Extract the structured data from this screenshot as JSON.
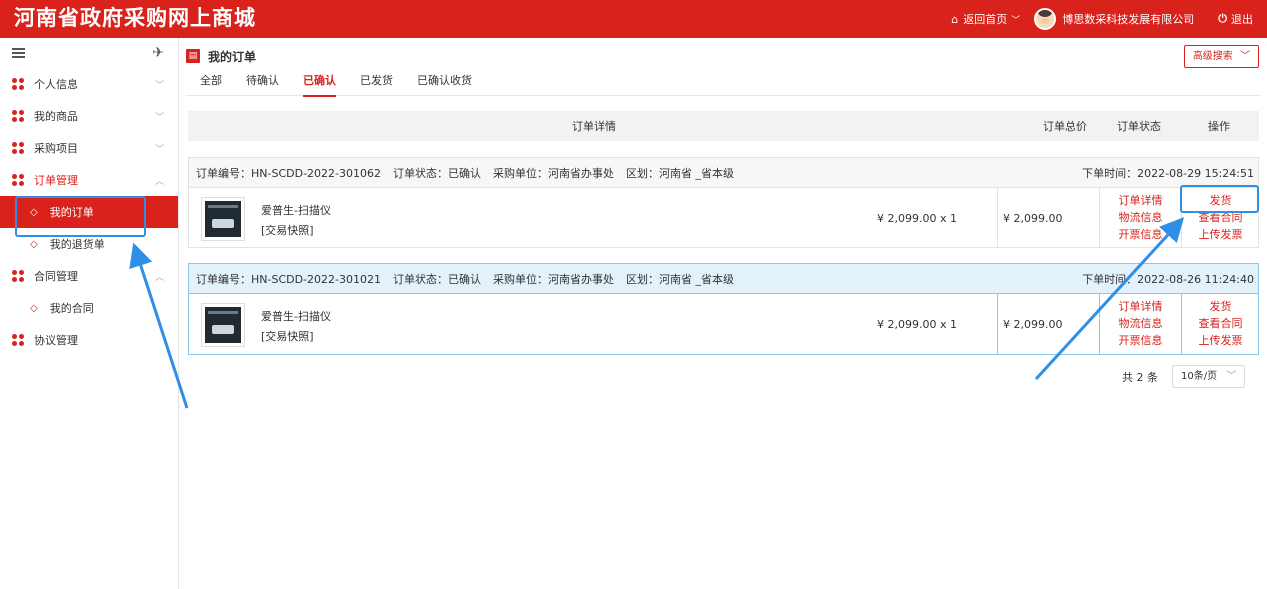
{
  "header": {
    "title": "河南省政府采购网上商城",
    "home_label": "返回首页",
    "company": "博思数采科技发展有限公司",
    "logout_label": "退出"
  },
  "sidebar": {
    "groups": [
      {
        "label": "个人信息"
      },
      {
        "label": "我的商品"
      },
      {
        "label": "采购项目"
      },
      {
        "label": "订单管理",
        "items": [
          {
            "label": "我的订单"
          },
          {
            "label": "我的退货单"
          }
        ]
      },
      {
        "label": "合同管理",
        "items": [
          {
            "label": "我的合同"
          }
        ]
      },
      {
        "label": "协议管理"
      }
    ]
  },
  "main": {
    "title": "我的订单",
    "advanced_search": "高级搜索",
    "tabs": [
      {
        "label": "全部"
      },
      {
        "label": "待确认"
      },
      {
        "label": "已确认"
      },
      {
        "label": "已发货"
      },
      {
        "label": "已确认收货"
      }
    ],
    "active_tab": 2,
    "table_headers": {
      "details": "订单详情",
      "total": "订单总价",
      "status": "订单状态",
      "ops": "操作"
    },
    "orders": [
      {
        "order_no": "订单编号：HN-SCDD-2022-301062",
        "status": "订单状态：已确认",
        "buyer": "采购单位：河南省办事处",
        "region": "区划：河南省 _省本级",
        "time": "下单时间：2022-08-29 15:24:51",
        "product": "爱普生-扫描仪",
        "snapshot": "[交易快照]",
        "qty": "¥ 2,099.00 x 1",
        "total": "¥ 2,099.00",
        "status_links": [
          "订单详情",
          "物流信息",
          "开票信息"
        ],
        "op_links": [
          "发货",
          "查看合同",
          "上传发票"
        ]
      },
      {
        "order_no": "订单编号：HN-SCDD-2022-301021",
        "status": "订单状态：已确认",
        "buyer": "采购单位：河南省办事处",
        "region": "区划：河南省 _省本级",
        "time": "下单时间：2022-08-26 11:24:40",
        "product": "爱普生-扫描仪",
        "snapshot": "[交易快照]",
        "qty": "¥ 2,099.00 x 1",
        "total": "¥ 2,099.00",
        "status_links": [
          "订单详情",
          "物流信息",
          "开票信息"
        ],
        "op_links": [
          "发货",
          "查看合同",
          "上传发票"
        ]
      }
    ],
    "pager": {
      "total": "共 2 条",
      "page_size": "10条/页"
    }
  },
  "colors": {
    "brand": "#d9221c",
    "highlight": "#2f8fe6"
  },
  "icons": [
    "home-icon",
    "power-icon",
    "menu-icon",
    "pin-icon",
    "flower-icon",
    "document-icon",
    "chevron-down-icon"
  ]
}
